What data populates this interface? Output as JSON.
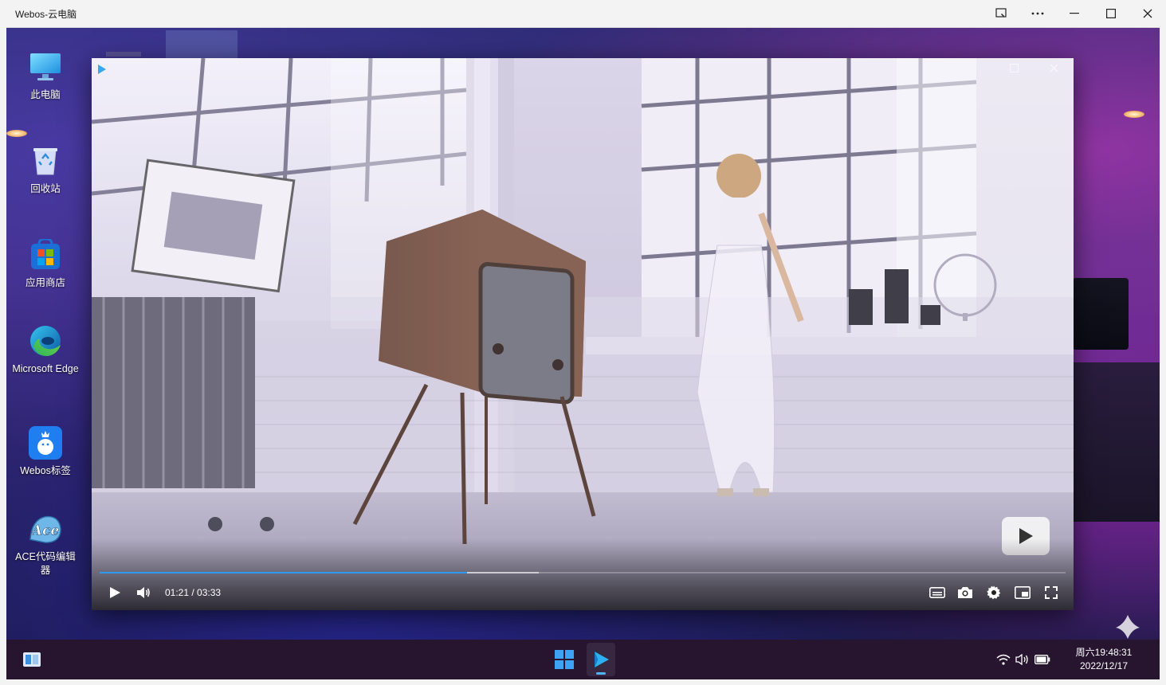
{
  "window": {
    "title": "Webos-云电脑"
  },
  "desktop": {
    "icons": [
      {
        "label": "此电脑",
        "icon": "monitor-icon"
      },
      {
        "label": "回收站",
        "icon": "recycle-bin-icon"
      },
      {
        "label": "应用商店",
        "icon": "store-icon"
      },
      {
        "label": "Microsoft Edge",
        "icon": "edge-icon"
      },
      {
        "label": "Webos标签",
        "icon": "webos-tag-icon"
      },
      {
        "label": "ACE代码编辑器",
        "icon": "ace-editor-icon"
      }
    ]
  },
  "player": {
    "current_time": "01:21",
    "duration": "03:33",
    "time_display": "01:21 / 03:33",
    "progress_fraction": 0.38,
    "buffered_fraction": 0.455,
    "accent_color": "#2e9bf0"
  },
  "taskbar": {
    "time": "周六19:48:31",
    "date": "2022/12/17"
  }
}
